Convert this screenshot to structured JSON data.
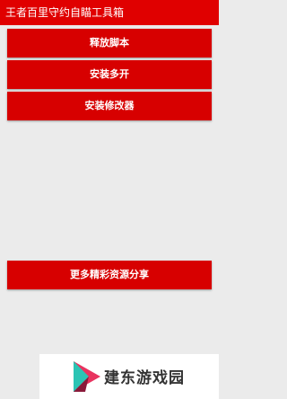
{
  "app_bar": {
    "title": "王者百里守约自瞄工具箱"
  },
  "buttons": [
    {
      "label": "释放脚本"
    },
    {
      "label": "安装多开"
    },
    {
      "label": "安装修改器"
    },
    {
      "label": "更多精彩资源分享"
    }
  ],
  "watermark": {
    "text": "建东游戏园",
    "logo_icon": "play-triangle-logo-icon",
    "colors": {
      "logo_pink": "#e8335f",
      "logo_teal": "#2bc4b4",
      "logo_dark": "#8a1a3a"
    }
  },
  "colors": {
    "accent": "#e00000",
    "button": "#d70000",
    "background": "#ebebeb"
  }
}
